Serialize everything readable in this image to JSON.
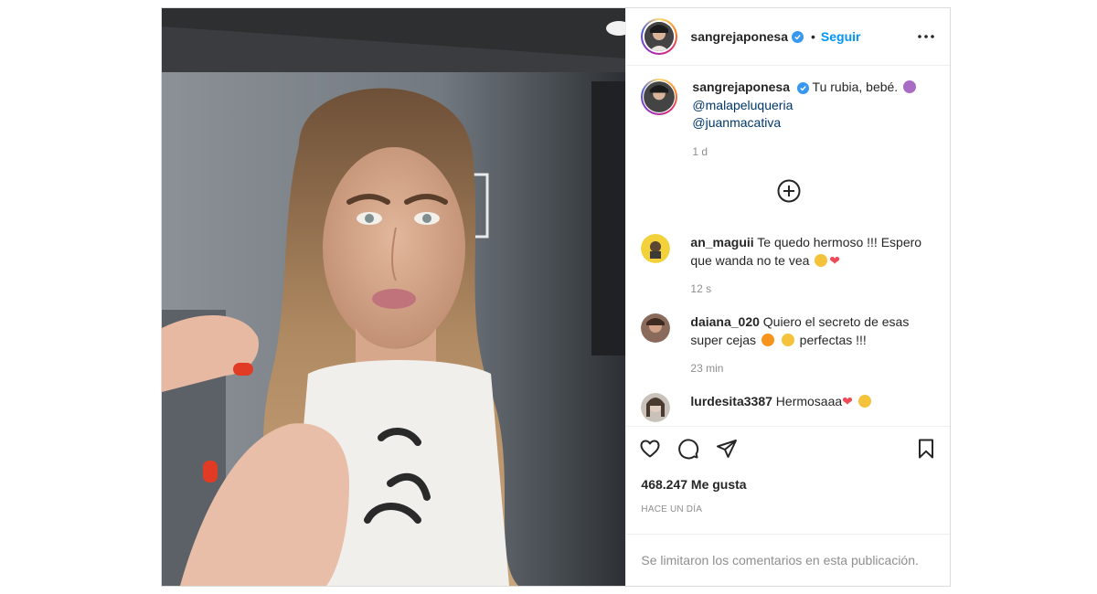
{
  "post": {
    "username": "sangrejaponesa",
    "follow_label": "Seguir",
    "separator": "•",
    "verified": true,
    "caption": {
      "text": "Tu rubia, bebé.",
      "mentions": [
        "@malapeluqueria",
        "@juanmacativa"
      ],
      "time": "1 d"
    },
    "comments": [
      {
        "user": "an_maguii",
        "text": "Te quedo hermoso !!! Espero que wanda no te vea",
        "time": "12 s"
      },
      {
        "user": "daiana_020",
        "text_before": "Quiero el secreto de esas super cejas",
        "text_after": "perfectas !!!",
        "time": "23 min"
      },
      {
        "user": "lurdesita3387",
        "text": "Hermosaaa"
      }
    ],
    "likes": "468.247 Me gusta",
    "posted_ago": "HACE UN DÍA",
    "comments_limited": "Se limitaron los comentarios en esta publicación."
  },
  "icons": {
    "verified": "verified-badge-icon",
    "more": "more-options-icon",
    "add_comment": "plus-circle-icon",
    "like": "heart-outline-icon",
    "comment": "comment-bubble-icon",
    "share": "paper-plane-icon",
    "save": "bookmark-icon"
  },
  "colors": {
    "link_blue": "#0095f6",
    "mention": "#00376b",
    "muted": "#8e8e8e",
    "verified": "#3897f0",
    "heart": "#ed4956"
  }
}
